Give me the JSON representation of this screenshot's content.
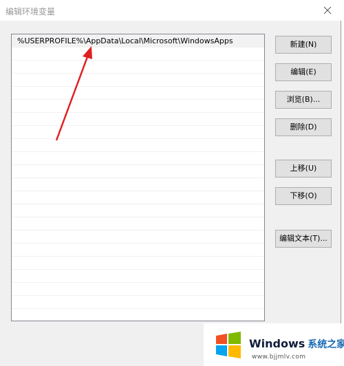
{
  "window": {
    "title": "编辑环境变量"
  },
  "list": {
    "items": [
      "%USERPROFILE%\\AppData\\Local\\Microsoft\\WindowsApps"
    ]
  },
  "buttons": {
    "new_label": "新建(N)",
    "edit_label": "编辑(E)",
    "browse_label": "浏览(B)...",
    "delete_label": "删除(D)",
    "move_up_label": "上移(U)",
    "move_down_label": "下移(O)",
    "edit_text_label": "编辑文本(T)..."
  },
  "watermark": {
    "brand": "Windows",
    "brand_cn": "系统之家",
    "url": "www.bjjmlv.com"
  },
  "colors": {
    "arrow": "#e02020",
    "logo_red": "#f25022",
    "logo_green": "#7fba00",
    "logo_blue": "#00a4ef",
    "logo_yellow": "#ffb900"
  }
}
